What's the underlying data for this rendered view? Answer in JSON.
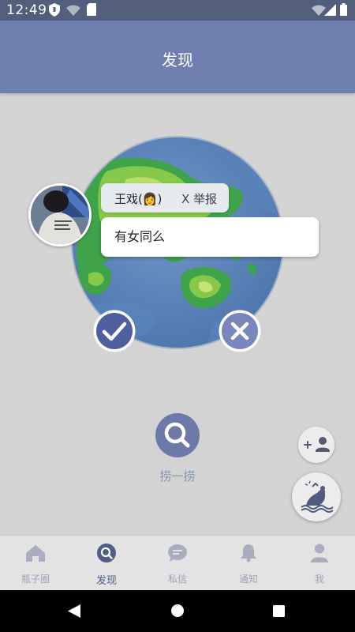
{
  "status_bar": {
    "time": "12:49",
    "left_icons": [
      "shield-icon",
      "wifi-question-icon",
      "sim-card-icon"
    ],
    "right_icons": [
      "wifi-icon",
      "signal-icon",
      "battery-icon"
    ]
  },
  "header": {
    "title": "发现"
  },
  "bottle": {
    "sender_name": "王戏(👩)",
    "report_label": "X 举报",
    "message": "有女同么",
    "accept_icon": "check-icon",
    "reject_icon": "close-icon"
  },
  "search": {
    "label": "捞一捞",
    "icon": "search-icon"
  },
  "fab": {
    "add_friend_icon": "add-user-icon",
    "throw_icon": "throw-bottle-icon"
  },
  "bottom_nav": {
    "items": [
      {
        "label": "瓶子圈",
        "icon": "home-icon",
        "active": false
      },
      {
        "label": "发现",
        "icon": "discover-icon",
        "active": true
      },
      {
        "label": "私信",
        "icon": "chat-icon",
        "active": false
      },
      {
        "label": "通知",
        "icon": "bell-icon",
        "active": false
      },
      {
        "label": "我",
        "icon": "person-icon",
        "active": false
      }
    ]
  },
  "colors": {
    "status_bar": "#515f7c",
    "header": "#6f7fb0",
    "accent": "#4f5d88",
    "background": "#d3d3d3"
  }
}
